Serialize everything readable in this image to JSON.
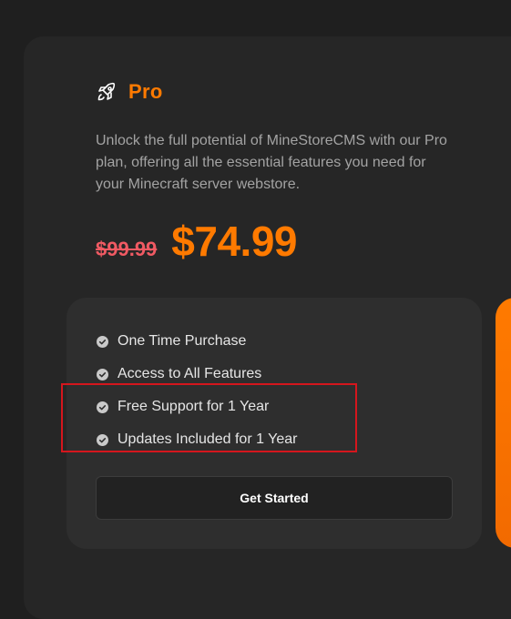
{
  "plan": {
    "name": "Pro",
    "icon": "rocket-icon",
    "description": "Unlock the full potential of MineStoreCMS with our Pro plan, offering all the essential features you need for your Minecraft server webstore.",
    "old_price": "$99.99",
    "price": "$74.99"
  },
  "features": [
    {
      "label": "One Time Purchase"
    },
    {
      "label": "Access to All Features"
    },
    {
      "label": "Free Support for 1 Year"
    },
    {
      "label": "Updates Included for 1 Year"
    }
  ],
  "cta": {
    "label": "Get Started"
  },
  "colors": {
    "accent": "#ff7a00",
    "strike_price": "#f05a63",
    "highlight": "#d5161d",
    "background": "#1f1f1f",
    "card": "#262626",
    "panel": "#2e2e2e"
  }
}
